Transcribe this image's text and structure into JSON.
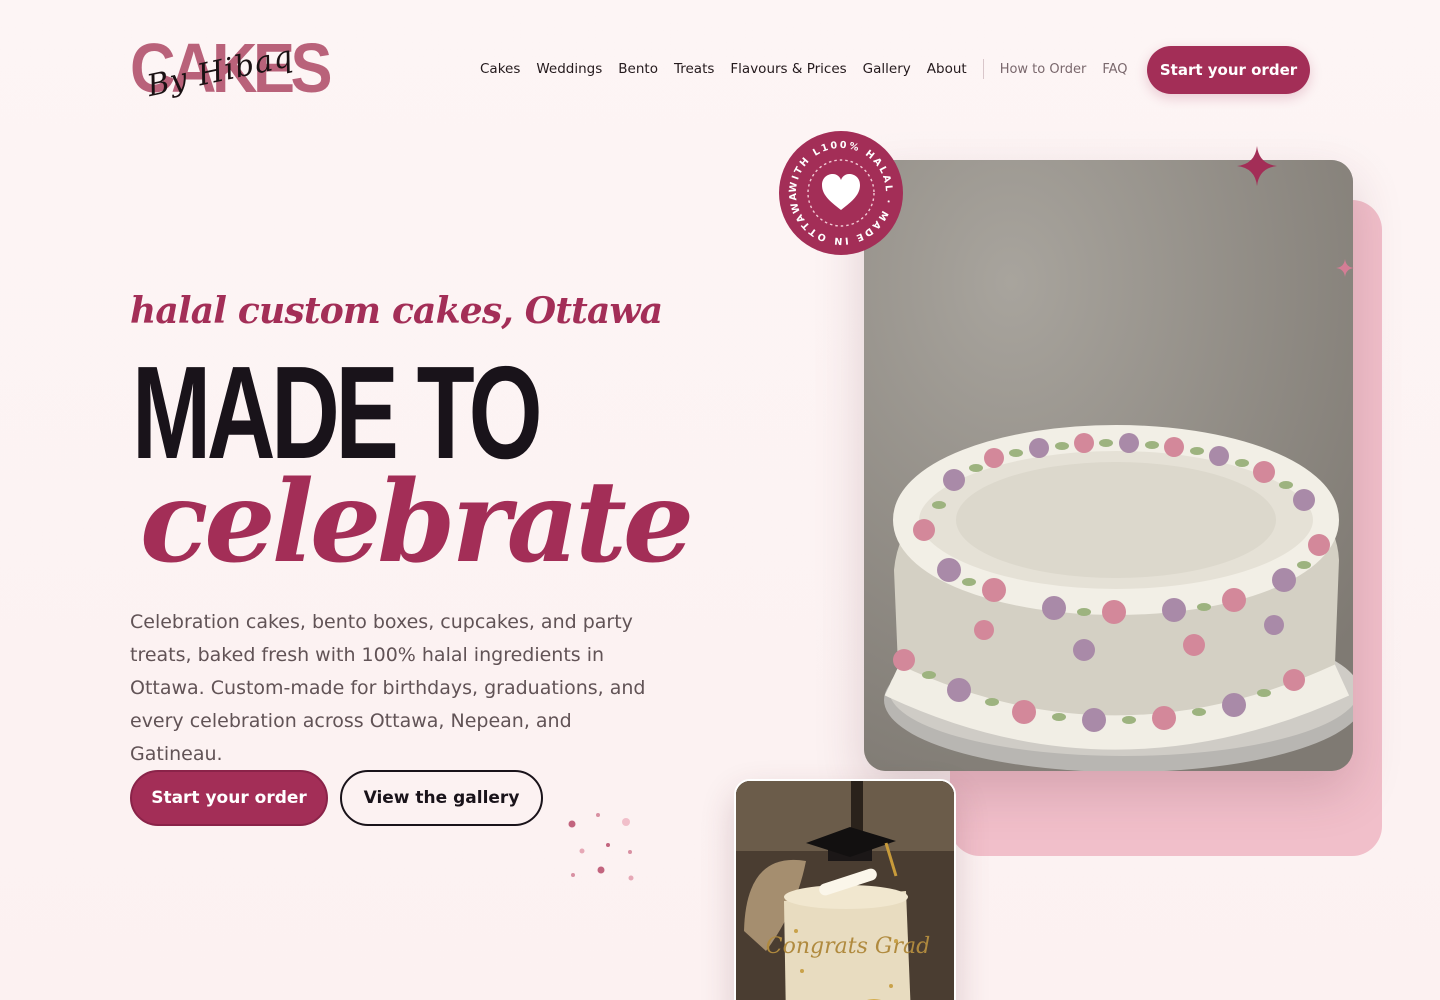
{
  "brand": {
    "logo_word": "CAKES",
    "logo_script": "By Hibaq"
  },
  "nav": {
    "links": [
      "Cakes",
      "Weddings",
      "Bento",
      "Treats",
      "Flavours & Prices",
      "Gallery",
      "About"
    ],
    "secondary_links": [
      "How to Order",
      "FAQ"
    ],
    "cta_label": "Start your order"
  },
  "hero": {
    "eyebrow": "halal custom cakes, Ottawa",
    "headline_line1": "MADE TO",
    "headline_line2": "celebrate",
    "description": "Celebration cakes, bento boxes, cupcakes, and party treats, baked fresh with 100% halal ingredients in Ottawa. Custom-made for birthdays, graduations, and every celebration across Ottawa, Nepean, and Gatineau.",
    "primary_button": "Start your order",
    "secondary_button": "View the gallery"
  },
  "badge": {
    "ring_text": "WITH L100% HALAL · MADE IN OTTAWA ·",
    "icon": "heart-icon"
  },
  "colors": {
    "accent": "#a32e57",
    "backdrop_pink": "#f1bfca",
    "page_bg": "#fdf5f5",
    "text_dark": "#19131a",
    "text_muted": "#615356"
  },
  "images": {
    "main": "floral-buttercream-cake-photo",
    "small": "graduation-cake-photo",
    "small_cake_text": "Congrats Grad"
  }
}
